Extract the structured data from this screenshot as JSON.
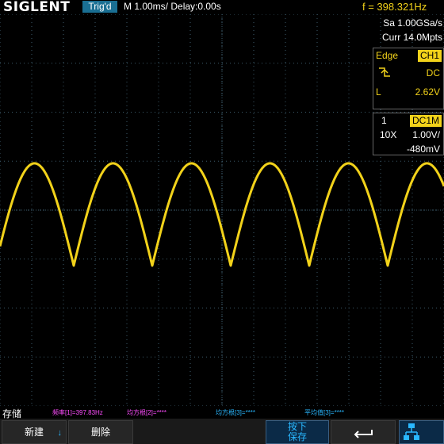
{
  "header": {
    "brand": "SIGLENT",
    "trigger_state": "Trig'd",
    "timebase": "M 1.00ms/ Delay:0.00s",
    "frequency": "f = 398.321Hz"
  },
  "acquisition": {
    "sample_rate": "Sa 1.00GSa/s",
    "memory_depth": "Curr 14.0Mpts"
  },
  "trigger_panel": {
    "type": "Edge",
    "source": "CH1",
    "slope_icon": "rising-edge-icon",
    "coupling": "DC",
    "level_label": "L",
    "level": "2.62V"
  },
  "channel_panel": {
    "channel": "1",
    "coupling_impedance": "DC1M",
    "probe": "10X",
    "scale": "1.00V/",
    "offset": "-480mV"
  },
  "measurements": [
    {
      "label": "频率[1]=397.83Hz",
      "color": "#ff4cff"
    },
    {
      "label": "均方根[2]=****",
      "color": "#ff4cff"
    },
    {
      "label": "均方根[3]=****",
      "color": "#29b7ff"
    },
    {
      "label": "平均值[3]=****",
      "color": "#29b7ff"
    }
  ],
  "softkeys": {
    "menu_title": "存储",
    "new_label": "新建",
    "delete_label": "删除",
    "press_save_line1": "按下",
    "press_save_line2": "保存",
    "back_icon": "return-arrow-icon",
    "network_icon": "network-icon"
  },
  "colors": {
    "trace": "#f2d21a",
    "accent": "#1a6f93",
    "grid": "#3c5a6a"
  }
}
